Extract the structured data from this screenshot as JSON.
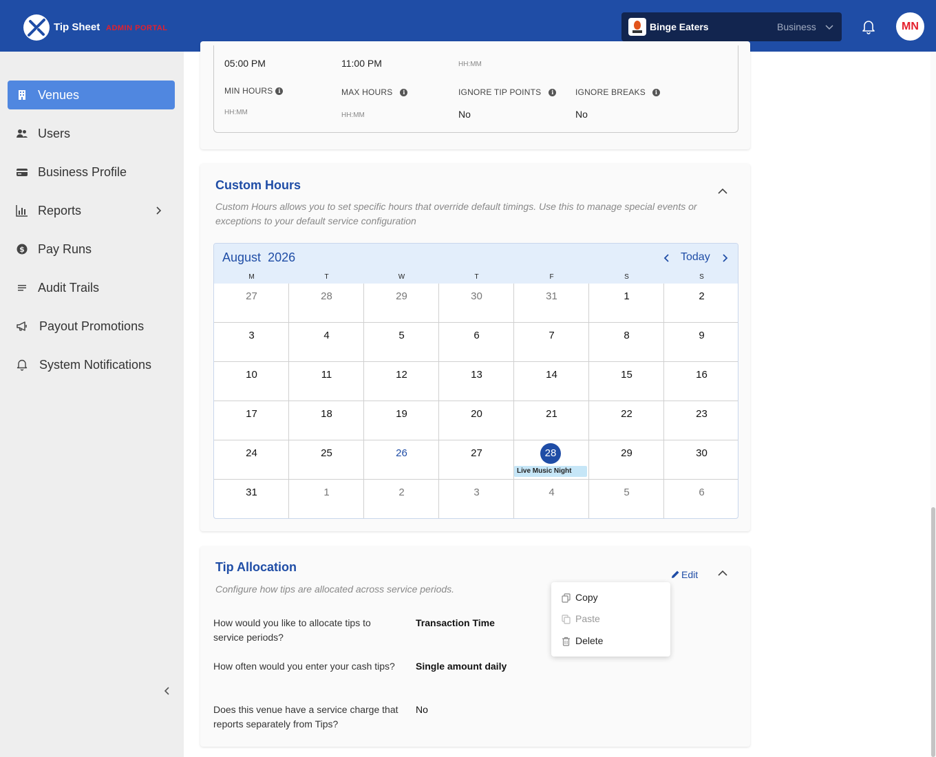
{
  "header": {
    "brand": "Tip Sheet",
    "brand_sub": "ADMIN PORTAL",
    "business_name": "Binge Eaters",
    "business_type": "Business",
    "avatar_initials": "MN",
    "bar_color": "#1f4da6"
  },
  "sidebar": {
    "items": [
      {
        "label": "Venues",
        "icon": "building-icon",
        "active": true
      },
      {
        "label": "Users",
        "icon": "users-icon"
      },
      {
        "label": "Business Profile",
        "icon": "card-icon"
      },
      {
        "label": "Reports",
        "icon": "bar-chart-icon",
        "has_children": true
      },
      {
        "label": "Pay Runs",
        "icon": "dollar-coin-icon"
      },
      {
        "label": "Audit Trails",
        "icon": "list-icon"
      },
      {
        "label": "Payout Promotions",
        "icon": "megaphone-icon"
      },
      {
        "label": "System Notifications",
        "icon": "bell-icon"
      }
    ]
  },
  "service_period": {
    "start_time": "05:00 PM",
    "end_time": "11:00 PM",
    "third_hint": "HH:MM",
    "min_hours_label": "MIN HOURS",
    "min_hours_hint": "HH:MM",
    "max_hours_label": "MAX HOURS",
    "max_hours_hint": "HH:MM",
    "ignore_tip_points_label": "IGNORE TIP POINTS",
    "ignore_tip_points_value": "No",
    "ignore_breaks_label": "IGNORE BREAKS",
    "ignore_breaks_value": "No"
  },
  "custom_hours": {
    "title": "Custom Hours",
    "description": "Custom Hours allows you to set specific hours that override default timings. Use this to manage special events or exceptions to your default service configuration",
    "calendar": {
      "month": "August",
      "year": "2026",
      "today_label": "Today",
      "weekdays": [
        "M",
        "T",
        "W",
        "T",
        "F",
        "S",
        "S"
      ],
      "weeks": [
        [
          "27",
          "28",
          "29",
          "30",
          "31",
          "1",
          "2"
        ],
        [
          "3",
          "4",
          "5",
          "6",
          "7",
          "8",
          "9"
        ],
        [
          "10",
          "11",
          "12",
          "13",
          "14",
          "15",
          "16"
        ],
        [
          "17",
          "18",
          "19",
          "20",
          "21",
          "22",
          "23"
        ],
        [
          "24",
          "25",
          "26",
          "27",
          "28",
          "29",
          "30"
        ],
        [
          "31",
          "1",
          "2",
          "3",
          "4",
          "5",
          "6"
        ]
      ],
      "selected_day": "28",
      "event_label": "Live Music Night"
    }
  },
  "tip_allocation": {
    "title": "Tip Allocation",
    "description": "Configure how tips are allocated across service periods.",
    "edit_label": "Edit",
    "questions": [
      {
        "q": "How would you like to allocate tips to service periods?",
        "a": "Transaction Time"
      },
      {
        "q": "How often would you enter your cash tips?",
        "a": "Single amount daily"
      },
      {
        "q": "Does this venue have a service charge that reports separately from Tips?",
        "a": "No"
      }
    ]
  },
  "context_menu": {
    "copy": "Copy",
    "paste": "Paste",
    "delete": "Delete"
  }
}
